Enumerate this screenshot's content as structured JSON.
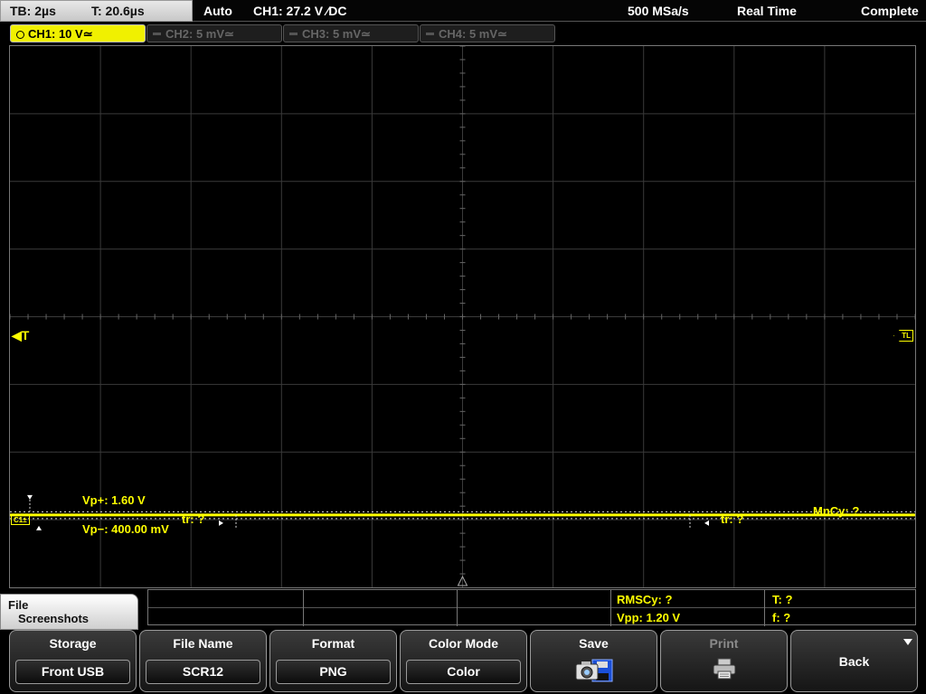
{
  "status_bar": {
    "timebase": "TB: 2µs",
    "trigger_time": "T: 20.6µs",
    "trigger_mode": "Auto",
    "trigger_info": "CH1: 27.2 V ∕DC",
    "sample_rate": "500 MSa/s",
    "acquisition_mode": "Real Time",
    "acquisition_state": "Complete"
  },
  "channel_tabs": [
    {
      "label": "CH1: 10 V",
      "coupling": "≃",
      "active": true
    },
    {
      "label": "CH2: 5 mV",
      "coupling": "≃",
      "active": false
    },
    {
      "label": "CH3: 5 mV",
      "coupling": "≃",
      "active": false
    },
    {
      "label": "CH4: 5 mV",
      "coupling": "≃",
      "active": false
    }
  ],
  "screen_markers": {
    "trigger_marker": "◀T",
    "trigger_level_tag": "TL",
    "channel_tag": "C1±",
    "vp_plus": "Vp+: 1.60 V",
    "vp_minus": "Vp−: 400.00 mV",
    "tr_left": "tr: ?",
    "tr_right": "tr: ?",
    "mncy": "MnCy: ?"
  },
  "waveform": {
    "channel": "CH1",
    "level_divisions": -2.93,
    "color": "#ffff00"
  },
  "file_panel": {
    "line1": "File",
    "line2": "Screenshots"
  },
  "measurements": {
    "rmscy": "RMSCy: ?",
    "vpp": "Vpp: 1.20 V",
    "period": "T: ?",
    "frequency": "f: ?"
  },
  "softkeys": [
    {
      "label": "Storage",
      "value": "Front USB"
    },
    {
      "label": "File Name",
      "value": "SCR12"
    },
    {
      "label": "Format",
      "value": "PNG"
    },
    {
      "label": "Color Mode",
      "value": "Color"
    },
    {
      "label": "Save",
      "icon": "camera-save-icon"
    },
    {
      "label": "Print",
      "icon": "printer-icon",
      "disabled": true
    },
    {
      "label": "Back"
    }
  ],
  "colors": {
    "ch1": "#ffff00",
    "grid": "#3a3a3a",
    "background": "#000000"
  }
}
